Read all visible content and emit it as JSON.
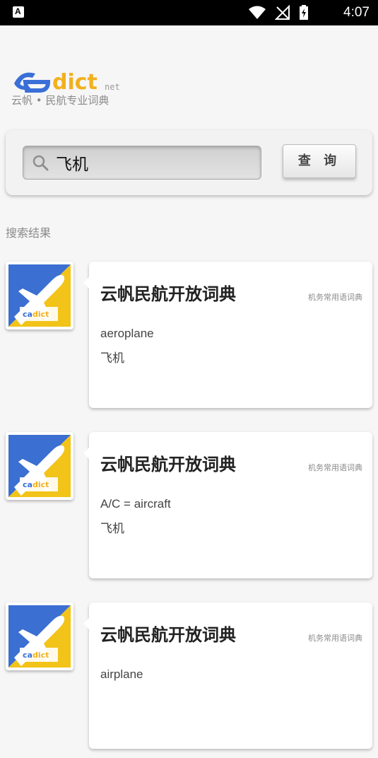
{
  "status_bar": {
    "time": "4:07",
    "left_icon": "a-accessibility-icon",
    "icons": [
      "wifi-icon",
      "no-signal-icon",
      "battery-charging-icon"
    ]
  },
  "logo": {
    "brand": "cadict",
    "net": "net",
    "tagline": "云帆 • 民航专业词典",
    "colors": {
      "blue": "#3a6fd8",
      "yellow": "#f2b01e"
    }
  },
  "search": {
    "value": "飞机",
    "placeholder": "",
    "button_label": "查 询"
  },
  "results_label": "搜索结果",
  "results": [
    {
      "dictionary": "云帆民航开放词典",
      "category": "机务常用语词典",
      "term": "aeroplane",
      "definition": "飞机"
    },
    {
      "dictionary": "云帆民航开放词典",
      "category": "机务常用语词典",
      "term": "A/C = aircraft",
      "definition": "飞机"
    },
    {
      "dictionary": "云帆民航开放词典",
      "category": "机务常用语词典",
      "term": "airplane",
      "definition": ""
    }
  ]
}
